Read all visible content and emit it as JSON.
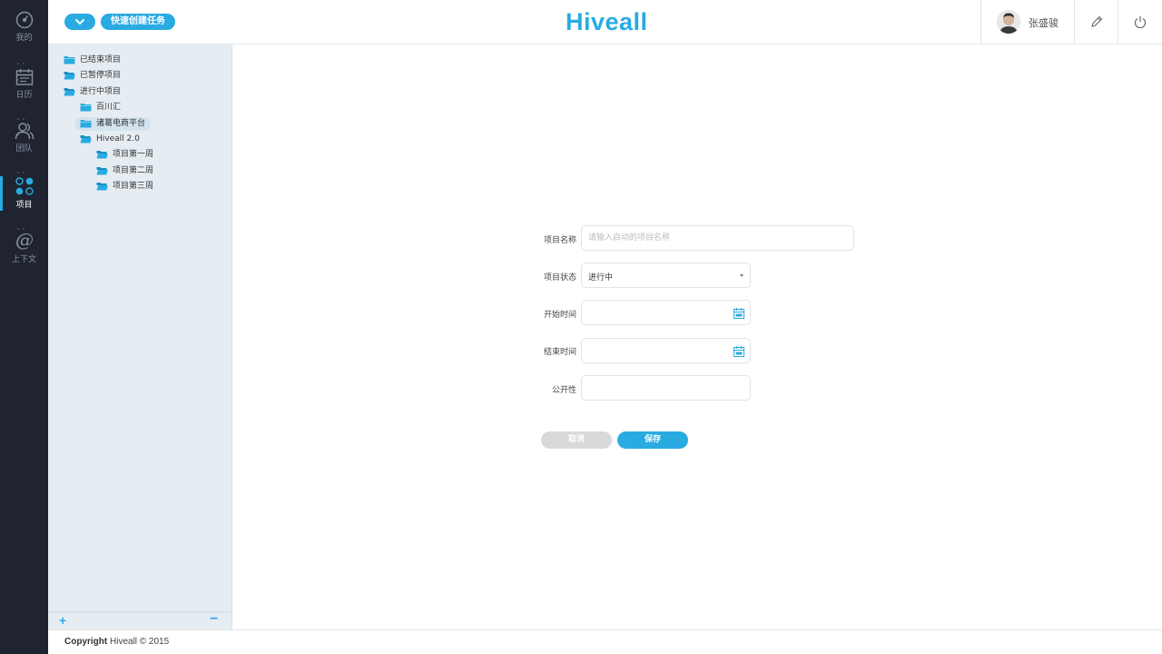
{
  "app": {
    "logo": "Hiveall"
  },
  "rail": {
    "items": [
      {
        "label": "我的",
        "icon": "dashboard-icon"
      },
      {
        "label": "日历",
        "icon": "calendar-icon"
      },
      {
        "label": "团队",
        "icon": "team-icon"
      },
      {
        "label": "项目",
        "icon": "project-icon",
        "active": true
      },
      {
        "label": "上下文",
        "icon": "at-icon"
      }
    ]
  },
  "header": {
    "quick_create_label": "快速创建任务",
    "user_name": "张盛骏"
  },
  "tree": {
    "nodes": [
      {
        "label": "已结束项目",
        "depth": 0,
        "icon": "folder-icon"
      },
      {
        "label": "已暂停项目",
        "depth": 0,
        "icon": "folder-open-icon"
      },
      {
        "label": "进行中项目",
        "depth": 0,
        "icon": "folder-open-icon"
      },
      {
        "label": "百川汇",
        "depth": 1,
        "icon": "folder-icon"
      },
      {
        "label": "诸葛电商平台",
        "depth": 1,
        "icon": "folder-icon",
        "selected": true
      },
      {
        "label": "Hiveall 2.0",
        "depth": 1,
        "icon": "folder-open-icon"
      },
      {
        "label": "项目第一周",
        "depth": 2,
        "icon": "folder-open-icon"
      },
      {
        "label": "项目第二周",
        "depth": 2,
        "icon": "folder-open-icon"
      },
      {
        "label": "项目第三周",
        "depth": 2,
        "icon": "folder-open-icon"
      }
    ],
    "add_label": "+",
    "remove_label": "−"
  },
  "form": {
    "name_label": "项目名称",
    "name_placeholder": "请输入启动的项目名称",
    "status_label": "项目状态",
    "status_value": "进行中",
    "start_label": "开始时间",
    "end_label": "结束时间",
    "public_label": "公开性",
    "cancel_label": "取消",
    "save_label": "保存"
  },
  "footer": {
    "copyright_prefix": "Copyright",
    "copyright_rest": " Hiveall © 2015"
  },
  "colors": {
    "accent": "#29abe2",
    "rail_bg": "#1f2430",
    "tree_bg": "#e6edf2"
  }
}
